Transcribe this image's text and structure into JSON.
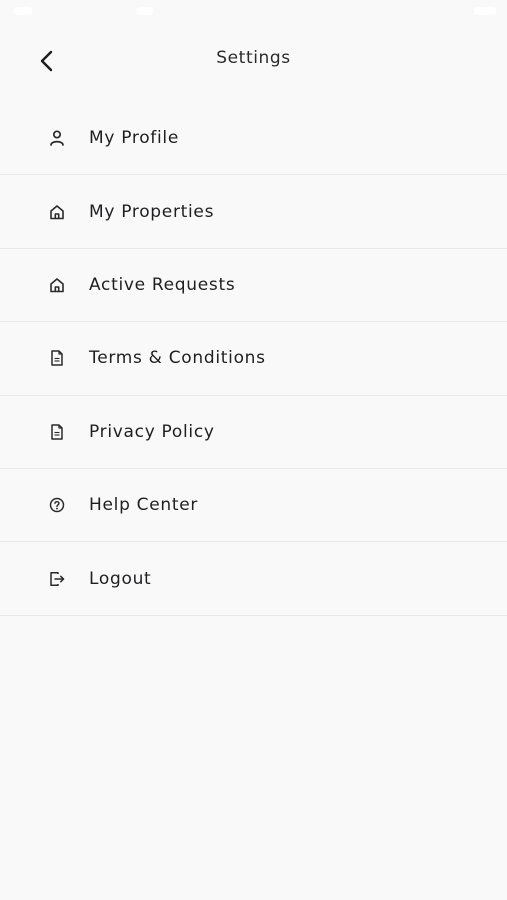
{
  "header": {
    "title": "Settings",
    "back_icon": "chevron-left-icon"
  },
  "menu": {
    "items": [
      {
        "label": "My Profile",
        "icon": "person-icon"
      },
      {
        "label": "My Properties",
        "icon": "home-icon"
      },
      {
        "label": "Active Requests",
        "icon": "home-icon"
      },
      {
        "label": "Terms & Conditions",
        "icon": "document-icon"
      },
      {
        "label": "Privacy Policy",
        "icon": "document-icon"
      },
      {
        "label": "Help Center",
        "icon": "help-circle-icon"
      },
      {
        "label": "Logout",
        "icon": "logout-icon"
      }
    ]
  },
  "colors": {
    "background": "#f9f9f9",
    "text": "#1f1f21",
    "divider": "#e9e9ea",
    "icon": "#2a2a2c"
  }
}
